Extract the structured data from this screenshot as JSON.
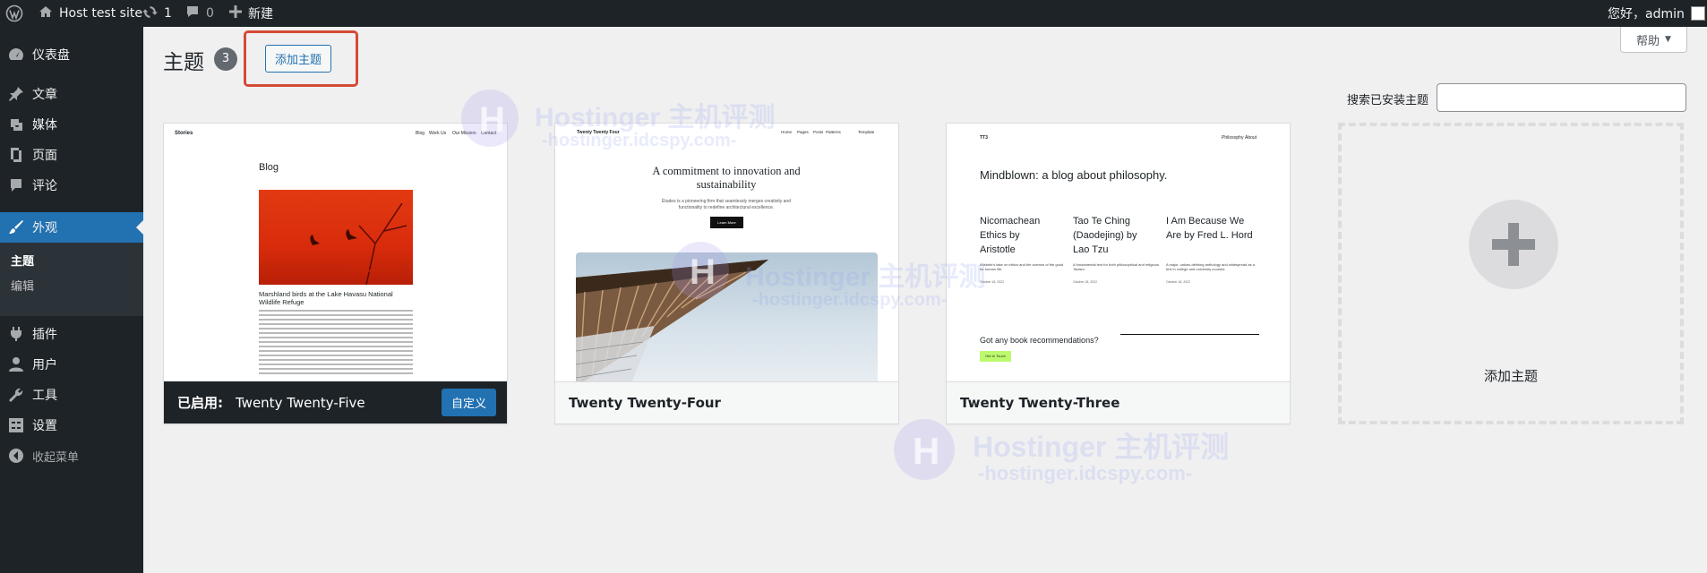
{
  "adminbar": {
    "site_name": "Host test site",
    "updates_count": "1",
    "comments_count": "0",
    "new_label": "新建",
    "greeting": "您好，admin"
  },
  "sidebar": {
    "items": [
      {
        "label": "仪表盘",
        "icon": "dashboard-icon"
      },
      {
        "label": "文章",
        "icon": "pin-icon"
      },
      {
        "label": "媒体",
        "icon": "media-icon"
      },
      {
        "label": "页面",
        "icon": "page-icon"
      },
      {
        "label": "评论",
        "icon": "comment-icon"
      },
      {
        "label": "外观",
        "icon": "brush-icon"
      },
      {
        "label": "插件",
        "icon": "plugin-icon"
      },
      {
        "label": "用户",
        "icon": "user-icon"
      },
      {
        "label": "工具",
        "icon": "wrench-icon"
      },
      {
        "label": "设置",
        "icon": "settings-icon"
      }
    ],
    "submenu": [
      "主题",
      "编辑"
    ],
    "collapse_label": "收起菜单"
  },
  "header": {
    "title": "主题",
    "count": "3",
    "add_button": "添加主题",
    "help_label": "帮助"
  },
  "search": {
    "label": "搜索已安装主题",
    "value": ""
  },
  "themes": [
    {
      "name": "Twenty Twenty-Five",
      "active": true,
      "active_prefix": "已启用:",
      "customize_label": "自定义",
      "preview": {
        "brand": "Stories",
        "nav": [
          "Blog",
          "Work Us",
          "Our Mission",
          "Contact"
        ],
        "heading": "Blog",
        "post_title": "Marshland birds at the Lake Havasu National Wildlife Refuge"
      }
    },
    {
      "name": "Twenty Twenty-Four",
      "active": false,
      "preview": {
        "brand": "Twenty Twenty Four",
        "nav": [
          "Home",
          "Pages",
          "Posts",
          "Patterns",
          "Template"
        ],
        "headline": "A commitment to innovation and sustainability",
        "body": "Études is a pioneering firm that seamlessly merges creativity and functionality to redefine architectural excellence.",
        "button": "Learn More"
      }
    },
    {
      "name": "Twenty Twenty-Three",
      "active": false,
      "preview": {
        "brand": "TT3",
        "nav": [
          "Philosophy",
          "About"
        ],
        "headline": "Mindblown: a blog about philosophy.",
        "posts": [
          {
            "title": "Nicomachean Ethics by Aristotle",
            "excerpt": "Aristotle's take on ethics and the science of the good for human life.",
            "date": "October 18, 2022"
          },
          {
            "title": "Tao Te Ching (Daodejing) by Lao Tzu",
            "excerpt": "A fundamental text for both philosophical and religious Taoism.",
            "date": "October 18, 2022"
          },
          {
            "title": "I Am Because We Are by Fred L. Hord",
            "excerpt": "A major, values-defining anthology and widespread as a text in college and university courses.",
            "date": "October 18, 2022"
          }
        ],
        "question": "Got any book recommendations?",
        "button": "Get In Touch"
      }
    }
  ],
  "add_new_card": {
    "label": "添加主题"
  },
  "watermark": {
    "brand": "Hostinger 主机评测",
    "url": "-hostinger.idcspy.com-"
  },
  "colors": {
    "adminbar": "#1d2327",
    "accent": "#2271b1",
    "highlight_box": "#d54a36",
    "background": "#f0f0f1"
  }
}
